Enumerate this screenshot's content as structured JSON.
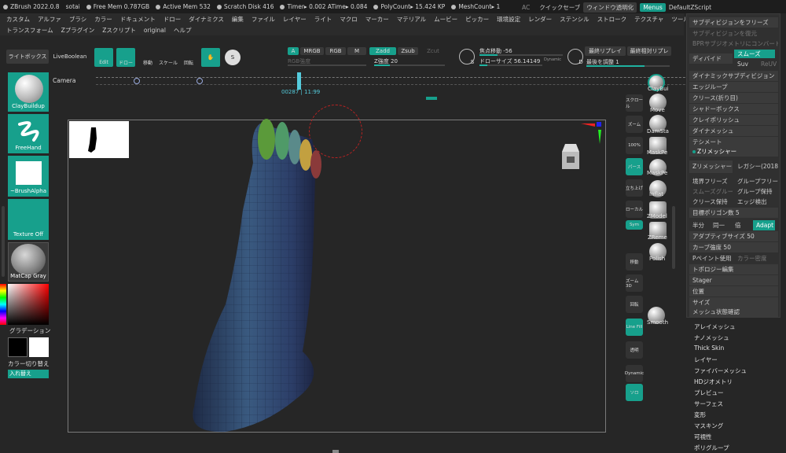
{
  "titlebar": {
    "app": "ZBrush 2022.0.8",
    "project": "sotai",
    "free_mem": "Free Mem 0.787GB",
    "active_mem": "Active Mem 532",
    "scratch": "Scratch Disk 416",
    "timer": "Timer▸ 0.002 ATime▸ 0.084",
    "polycount": "PolyCount▸ 15.424 KP",
    "meshcount": "MeshCount▸ 1",
    "ac": "AC",
    "quicksave": "クイックセーブ",
    "window_transparency": "ウィンドウ透明化",
    "menus_btn": "Menus",
    "default_script": "DefaultZScript"
  },
  "menus_row1": [
    "カスタム",
    "アルファ",
    "ブラシ",
    "カラー",
    "ドキュメント",
    "ドロー",
    "ダイナミクス",
    "編集",
    "ファイル",
    "レイヤー",
    "ライト",
    "マクロ",
    "マーカー",
    "マテリアル",
    "ムービー",
    "ピッカー",
    "環境設定",
    "レンダー",
    "ステンシル",
    "ストローク",
    "テクスチャ",
    "ツール"
  ],
  "menus_row2": [
    "トランスフォーム",
    "Zプラグイン",
    "Zスクリプト",
    "original",
    "ヘルプ"
  ],
  "toolbar": {
    "lightbox": "ライトボックス",
    "liveboolean": "LiveBoolean",
    "edit": "Edit",
    "draw": "ドロー",
    "move": "移動",
    "scale": "スケール",
    "rotate": "回転",
    "a": "A",
    "mrgb": "MRGB",
    "rgb": "RGB",
    "m": "M",
    "zadd": "Zadd",
    "zsub": "Zsub",
    "zcut": "Zcut",
    "rgb_intensity": "RGB強度",
    "z_intensity": "Z強度 20",
    "s": "S",
    "focal_shift": "焦点移動 -56",
    "draw_size": "ドローサイズ 56.14149",
    "dynamic": "Dynamic",
    "d": "D",
    "last_replay": "最終リプレイ",
    "last_relative_replay": "最終相対リプレ",
    "adjust_last": "最後を調整 1"
  },
  "camera": {
    "label": "Camera",
    "time": "00287 | 11:99"
  },
  "leftpanel": {
    "brush": "ClayBuildup",
    "stroke": "FreeHand",
    "alpha": "~BrushAlpha",
    "texture": "Texture Off",
    "material": "MatCap Gray",
    "gradient": "グラデーション",
    "color_switch": "カラー切り替え",
    "swap": "入れ替え"
  },
  "righttools": {
    "claybuild": "ClayBui",
    "move": "Move",
    "damstandard": "DamSta",
    "maskpen": "MaskPe",
    "inflate": "Inflat",
    "zmodeler": "ZModel",
    "zremesher": "ZReme",
    "polish": "Polish",
    "smooth": "Smooth",
    "icon_labels": [
      "スクロール",
      "ズーム",
      "100%",
      "パース",
      "立ち上げ",
      "ローカル",
      "Sym",
      "移動",
      "ズーム3D",
      "回転",
      "Line Fill",
      "透明",
      "Dynamic",
      "ソロ"
    ]
  },
  "rpanel": {
    "freeze": "サブディビジョンをフリーズ",
    "restore": "サブディビジョンを復元",
    "convert": "BPRサブジオメトリにコンバート",
    "divide": "ディバイド",
    "smooth": "スムーズ",
    "suv": "Suv",
    "reuv": "ReUV",
    "dynamic_subdiv": "ダイナミックサブディビジョン",
    "edgeloop": "エッジループ",
    "crease": "クリース(折り目)",
    "shadowbox": "シャドーボックス",
    "claypolish": "クレイポリッシュ",
    "dynamesh": "ダイナメッシュ",
    "tessimate": "テシメート",
    "zremesher_hdr": "Zリメッシャー",
    "zremesher_btn": "Zリメッシャー",
    "legacy": "レガシー(2018)",
    "freeze_border": "境界フリーズ",
    "freeze_groups": "グループフリー",
    "smooth_groups": "スムーズグルー",
    "keep_groups": "グループ保持",
    "keep_creases": "クリース保持",
    "detect_edges": "エッジ検出",
    "target_poly": "目標ポリゴン数 5",
    "half": "半分",
    "same": "同一",
    "double": "倍",
    "adapt": "Adapt",
    "adaptive_size": "アダプティブサイズ 50",
    "curve_strength": "カーブ強度 50",
    "use_polypaint": "Pペイント使用",
    "color_density": "カラー密度",
    "topology_edit": "トポロジー編集",
    "stager": "Stager",
    "position": "位置",
    "size": "サイズ",
    "mesh_integrity": "メッシュ状態確認"
  },
  "rlist": [
    "アレイメッシュ",
    "ナノメッシュ",
    "Thick Skin",
    "レイヤー",
    "ファイバーメッシュ",
    "HDジオメトリ",
    "プレビュー",
    "サーフェス",
    "変形",
    "マスキング",
    "可視性",
    "ポリグループ"
  ],
  "colors": {
    "accent": "#17a08c",
    "panel": "#303030",
    "bg": "#262626"
  }
}
